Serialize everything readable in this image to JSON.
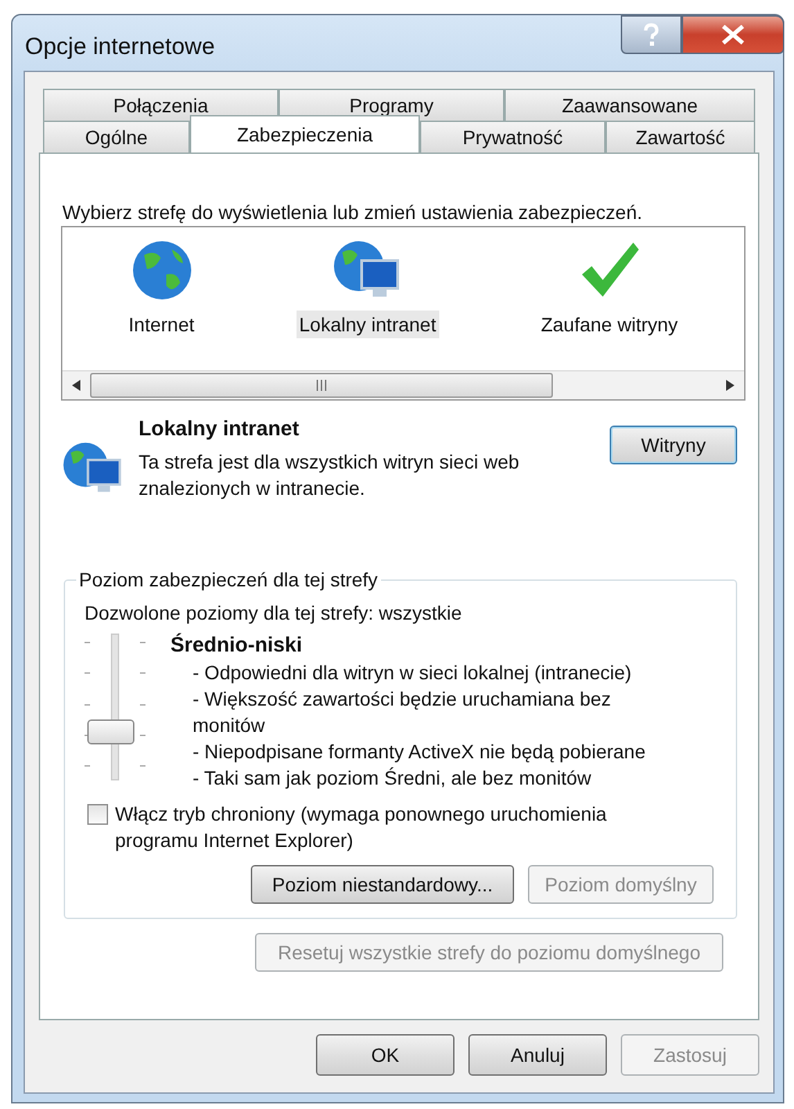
{
  "window": {
    "title": "Opcje internetowe"
  },
  "tab_rows": [
    [
      {
        "label": "Połączenia",
        "selected": false
      },
      {
        "label": "Programy",
        "selected": false
      },
      {
        "label": "Zaawansowane",
        "selected": false
      }
    ],
    [
      {
        "label": "Ogólne",
        "selected": false
      },
      {
        "label": "Zabezpieczenia",
        "selected": true
      },
      {
        "label": "Prywatność",
        "selected": false
      },
      {
        "label": "Zawartość",
        "selected": false
      }
    ]
  ],
  "zone_prompt": "Wybierz strefę do wyświetlenia lub zmień ustawienia zabezpieczeń.",
  "zones": [
    {
      "kind": "internet",
      "label": "Internet",
      "selected": false
    },
    {
      "kind": "intranet",
      "label": "Lokalny intranet",
      "selected": true
    },
    {
      "kind": "trusted",
      "label": "Zaufane witryny",
      "selected": false
    }
  ],
  "zone_info": {
    "kind": "intranet",
    "title": "Lokalny intranet",
    "description": "Ta strefa jest dla wszystkich witryn sieci web znalezionych w intranecie.",
    "button": "Witryny"
  },
  "security_level": {
    "legend": "Poziom zabezpieczeń dla tej strefy",
    "allowed": "Dozwolone poziomy dla tej strefy: wszystkie",
    "level": 0.25,
    "name": "Średnio-niski",
    "points": [
      "- Odpowiedni dla witryn w sieci lokalnej (intranecie)",
      "- Większość zawartości będzie uruchamiana bez monitów",
      "- Niepodpisane formanty ActiveX nie będą pobierane",
      "- Taki sam jak poziom Średni, ale bez monitów"
    ],
    "protected_mode": {
      "label": "Włącz tryb chroniony (wymaga ponownego uruchomienia programu Internet Explorer)",
      "checked": false
    },
    "buttons": [
      {
        "label": "Poziom niestandardowy...",
        "disabled": false
      },
      {
        "label": "Poziom domyślny",
        "disabled": true
      }
    ]
  },
  "reset_button": {
    "label": "Resetuj wszystkie strefy do poziomu domyślnego",
    "disabled": true
  },
  "dialog_buttons": [
    {
      "label": "OK",
      "disabled": false
    },
    {
      "label": "Anuluj",
      "disabled": false
    },
    {
      "label": "Zastosuj",
      "disabled": true
    }
  ]
}
